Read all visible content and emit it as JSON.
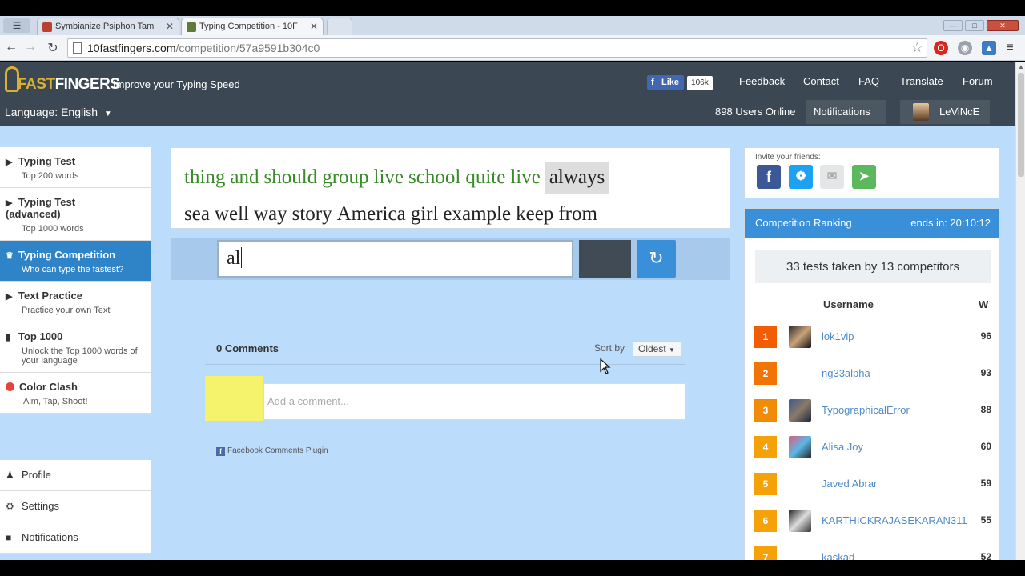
{
  "browser": {
    "tabs": [
      {
        "title": "Symbianize Psiphon Tam",
        "active": false
      },
      {
        "title": "Typing Competition - 10F",
        "active": true
      }
    ],
    "url_host": "10fastfingers.com",
    "url_path": "/competition/57a9591b304c0"
  },
  "header": {
    "logo_text_a": "FAST",
    "logo_text_b": "FINGERS",
    "slogan": "Improve your Typing Speed",
    "fb_like": "Like",
    "fb_count": "106k",
    "nav": [
      "Feedback",
      "Contact",
      "FAQ",
      "Translate",
      "Forum"
    ],
    "language": "Language: English",
    "users_online": "898 Users Online",
    "notifications": "Notifications",
    "username": "LeViNcE"
  },
  "sidebar": {
    "items": [
      {
        "title": "Typing Test",
        "sub": "Top 200 words",
        "icon": "play-icon"
      },
      {
        "title": "Typing Test (advanced)",
        "sub": "Top 1000 words",
        "icon": "play-icon"
      },
      {
        "title": "Typing Competition",
        "sub": "Who can type the fastest?",
        "icon": "trophy-icon"
      },
      {
        "title": "Text Practice",
        "sub": "Practice your own Text",
        "icon": "play-icon"
      },
      {
        "title": "Top 1000",
        "sub": "Unlock the Top 1000 words of your language",
        "icon": "signal-icon"
      },
      {
        "title": "Color Clash",
        "sub": "Aim, Tap, Shoot!",
        "icon": "red-dot-icon"
      }
    ],
    "bottom": [
      "Profile",
      "Settings",
      "Notifications"
    ]
  },
  "test": {
    "words_done": [
      "thing",
      "and",
      "should",
      "group",
      "live",
      "school",
      "quite",
      "live"
    ],
    "word_current": "always",
    "words_next": [
      "sea",
      "well",
      "way",
      "story",
      "America",
      "girl",
      "example",
      "keep",
      "from"
    ],
    "input_value": "al"
  },
  "comments": {
    "count_label": "0 Comments",
    "sort_label": "Sort by",
    "sort_value": "Oldest",
    "placeholder": "Add a comment...",
    "plugin_label": "Facebook Comments Plugin"
  },
  "right": {
    "invite_label": "Invite your friends:",
    "ranking_title": "Competition Ranking",
    "ends_in": "ends in: 20:10:12",
    "tests_summary": "33 tests taken by 13 competitors",
    "col_username": "Username",
    "col_wpm": "WPM",
    "ranking": [
      {
        "rank": "1",
        "name": "lok1vip",
        "wpm": "96",
        "color": "#f25c05"
      },
      {
        "rank": "2",
        "name": "ng33alpha",
        "wpm": "93",
        "color": "#f27405"
      },
      {
        "rank": "3",
        "name": "TypographicalError",
        "wpm": "88",
        "color": "#f28b05"
      },
      {
        "rank": "4",
        "name": "Alisa Joy",
        "wpm": "60",
        "color": "#f5a108"
      },
      {
        "rank": "5",
        "name": "Javed Abrar",
        "wpm": "59",
        "color": "#f5a108"
      },
      {
        "rank": "6",
        "name": "KARTHICKRAJASEKARAN311",
        "wpm": "55",
        "color": "#f5a108"
      },
      {
        "rank": "7",
        "name": "kaskad",
        "wpm": "52",
        "color": "#f5a108"
      }
    ]
  },
  "colors": {
    "header_bg": "#3b4752",
    "page_bg": "#bcdcfb",
    "accent_blue": "#3a8fd9",
    "correct_green": "#3a8a2a"
  }
}
